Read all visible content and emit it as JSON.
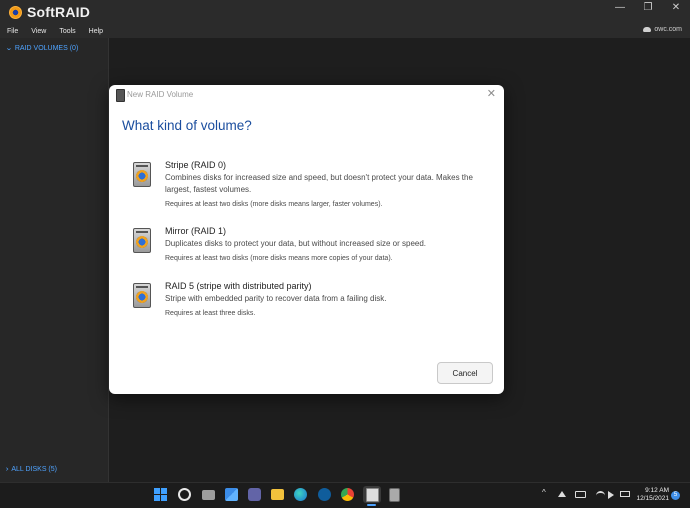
{
  "app": {
    "title": "SoftRAID",
    "menu": [
      "File",
      "View",
      "Tools",
      "Help"
    ],
    "owc_link": "owc.com"
  },
  "sidebar": {
    "raid_volumes": "RAID VOLUMES (0)",
    "all_disks": "ALL DISKS (5)"
  },
  "dialog": {
    "window_title": "New RAID Volume",
    "heading": "What kind of volume?",
    "options": [
      {
        "title": "Stripe (RAID 0)",
        "description": "Combines disks for increased size and speed, but doesn't protect your data. Makes the largest, fastest volumes.",
        "note": "Requires at least two disks (more disks means larger, faster volumes)."
      },
      {
        "title": "Mirror (RAID 1)",
        "description": "Duplicates disks to protect your data, but without increased size or speed.",
        "note": "Requires at least two disks (more disks means more copies of your data)."
      },
      {
        "title": "RAID 5 (stripe with distributed parity)",
        "description": "Stripe with embedded parity to recover data from a failing disk.",
        "note": "Requires at least three disks."
      }
    ],
    "cancel_label": "Cancel",
    "close_glyph": "✕"
  },
  "taskbar": {
    "time": "9:12 AM",
    "date": "12/15/2021",
    "notification_count": "5",
    "tray_chevron": "^",
    "app_icons": [
      "start-icon",
      "search-icon",
      "task-view-icon",
      "widgets-icon",
      "teams-chat-icon",
      "file-explorer-icon",
      "edge-icon",
      "stocks-icon",
      "chrome-icon",
      "softraid-icon",
      "softraid-monitor-icon"
    ]
  },
  "window_controls": {
    "minimize": "—",
    "maximize": "❐",
    "close": "✕"
  },
  "colors": {
    "accent": "#4fa3ff",
    "heading": "#1a4d9e",
    "background": "#1f1f1f"
  }
}
